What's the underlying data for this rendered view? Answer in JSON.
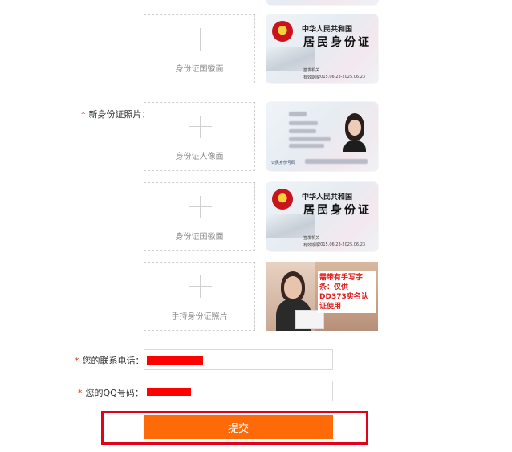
{
  "uploads": {
    "back_1": "身份证国徽面",
    "portrait": "身份证人像面",
    "back_2": "身份证国徽面",
    "handheld": "手持身份证照片"
  },
  "samples": {
    "back": {
      "nation": "中华人民共和国",
      "title": "居民身份证",
      "authority_label": "签发机关",
      "validity_label": "有效期限",
      "validity": "2015.06.23-2025.06.23"
    },
    "portrait": {
      "id_label": "公民身份号码"
    },
    "handheld": {
      "note": "需带有手写字条：仅供DD373实名认证使用"
    }
  },
  "form": {
    "new_id_label": "新身份证照片：",
    "phone_label": "您的联系电话：",
    "qq_label": "您的QQ号码："
  },
  "submit_label": "提交"
}
